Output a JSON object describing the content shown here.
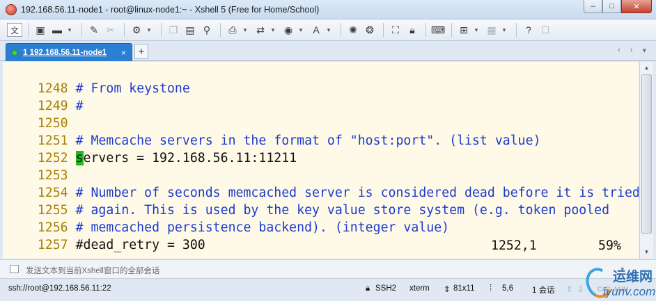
{
  "window": {
    "title": "192.168.56.11-node1 - root@linux-node1:~ - Xshell 5 (Free for Home/School)",
    "controls": {
      "minimize": "–",
      "maximize": "□",
      "close": "✕"
    }
  },
  "toolbar": {
    "text_button": "文",
    "icons": [
      "new-session-icon",
      "open-folder-icon",
      "dropdown-icon",
      "wand-icon",
      "disconnect-icon",
      "properties-icon",
      "dropdown-icon",
      "copy-icon",
      "paste-icon",
      "find-icon",
      "print-icon",
      "dropdown-icon",
      "transfer-icon",
      "dropdown-icon",
      "globe-icon",
      "dropdown-icon",
      "font-icon",
      "dropdown-icon",
      "xftp-icon",
      "xmanager-icon",
      "fullscreen-icon",
      "lock-icon",
      "keyboard-icon",
      "add-pane-icon",
      "dropdown-icon",
      "layout-icon",
      "dropdown-icon",
      "help-icon",
      "chat-icon"
    ]
  },
  "tabs": {
    "active": {
      "index": "1",
      "label": "1 192.168.56.11-node1",
      "close": "×"
    },
    "add": "+",
    "nav": [
      "‹",
      "›",
      "▾"
    ]
  },
  "terminal": {
    "lines": [
      {
        "num": "1248",
        "kind": "comment",
        "text": "# From keystone"
      },
      {
        "num": "1249",
        "kind": "comment",
        "text": "#"
      },
      {
        "num": "1250",
        "kind": "blank",
        "text": ""
      },
      {
        "num": "1251",
        "kind": "comment",
        "text": "# Memcache servers in the format of \"host:port\". (list value)"
      },
      {
        "num": "1252",
        "kind": "cursor",
        "cursor_char": "s",
        "text": "ervers = 192.168.56.11:11211"
      },
      {
        "num": "1253",
        "kind": "blank",
        "text": ""
      },
      {
        "num": "1254",
        "kind": "comment",
        "text": "# Number of seconds memcached server is considered dead before it is tried"
      },
      {
        "num": "1255",
        "kind": "comment",
        "text": "# again. This is used by the key value store system (e.g. token pooled"
      },
      {
        "num": "1256",
        "kind": "comment",
        "text": "# memcached persistence backend). (integer value)"
      },
      {
        "num": "1257",
        "kind": "text",
        "text": "#dead_retry = 300"
      }
    ],
    "position": "1252,1",
    "percent": "59%"
  },
  "compose": {
    "placeholder": "发送文本到当前Xshell窗口的全部会话"
  },
  "statusbar": {
    "connection": "ssh://root@192.168.56.11:22",
    "protocol": "SSH2",
    "terminal_type": "xterm",
    "size": "81x11",
    "cursor_pos": "5,6",
    "sessions": "1 会话",
    "cap": "CAP",
    "num": "NUM"
  },
  "watermark": {
    "cn": "运维网",
    "en": "iyunv.com"
  },
  "colors": {
    "terminal_bg": "#fffae8",
    "line_number": "#a6820a",
    "comment": "#1b3bd0",
    "cursor": "#22b922",
    "tab_active": "#2b7fd3"
  }
}
